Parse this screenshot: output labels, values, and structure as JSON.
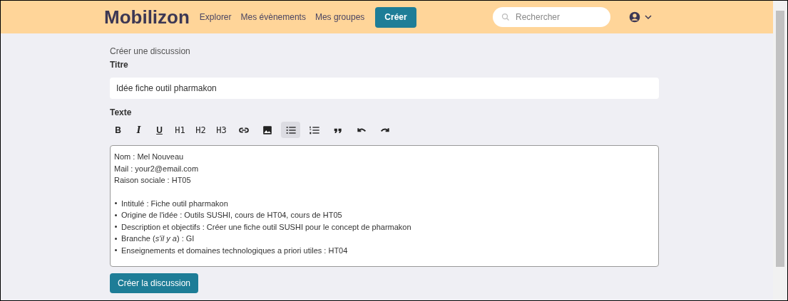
{
  "header": {
    "logo": "Mobilizon",
    "nav": [
      "Explorer",
      "Mes évènements",
      "Mes groupes"
    ],
    "create_button": "Créer",
    "search": {
      "placeholder": "Rechercher"
    }
  },
  "form": {
    "heading": "Créer une discussion",
    "title_label": "Titre",
    "title_value": "Idée fiche outil pharmakon",
    "text_label": "Texte",
    "toolbar": [
      {
        "kind": "bold",
        "label": "B",
        "selected": false
      },
      {
        "kind": "italic",
        "label": "I",
        "selected": false
      },
      {
        "kind": "underline",
        "label": "U",
        "selected": false
      },
      {
        "kind": "text",
        "label": "H1",
        "selected": false
      },
      {
        "kind": "text",
        "label": "H2",
        "selected": false
      },
      {
        "kind": "text",
        "label": "H3",
        "selected": false
      },
      {
        "kind": "link",
        "selected": false
      },
      {
        "kind": "image",
        "selected": false
      },
      {
        "kind": "bullets",
        "selected": true
      },
      {
        "kind": "numbers",
        "selected": false
      },
      {
        "kind": "quote",
        "selected": false
      },
      {
        "kind": "undo",
        "selected": false
      },
      {
        "kind": "redo",
        "selected": false
      }
    ],
    "paragraphs": [
      "Nom : Mel Nouveau",
      "Mail : your2@email.com",
      "Raison sociale : HT05"
    ],
    "bullets": [
      "Intitulé : Fiche outil pharmakon",
      "Origine de l'idée : Outils SUSHI, cours de HT04, cours de HT05",
      "Description et objectifs : Créer une fiche outil SUSHI pour le concept de pharmakon",
      "Branche (*s'il y a*) : GI",
      "Enseignements et domaines technologiques a priori utiles : HT04"
    ],
    "submit": "Créer la discussion"
  }
}
